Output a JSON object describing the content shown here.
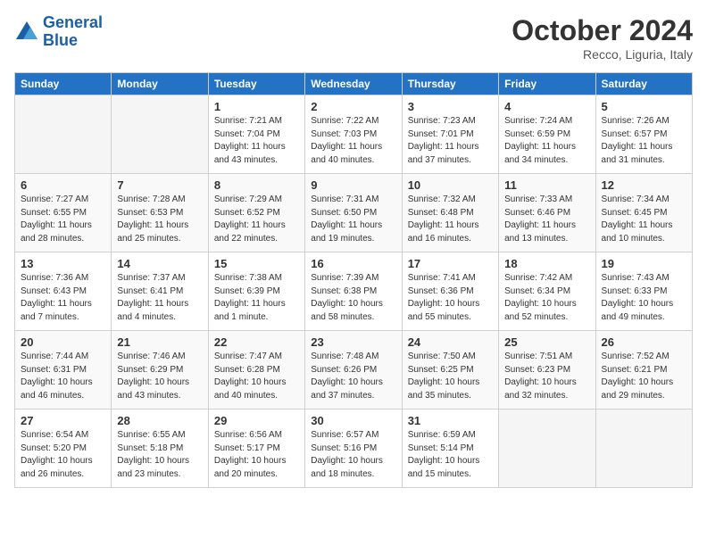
{
  "header": {
    "logo_line1": "General",
    "logo_line2": "Blue",
    "month": "October 2024",
    "location": "Recco, Liguria, Italy"
  },
  "days_of_week": [
    "Sunday",
    "Monday",
    "Tuesday",
    "Wednesday",
    "Thursday",
    "Friday",
    "Saturday"
  ],
  "weeks": [
    [
      {
        "day": "",
        "info": ""
      },
      {
        "day": "",
        "info": ""
      },
      {
        "day": "1",
        "info": "Sunrise: 7:21 AM\nSunset: 7:04 PM\nDaylight: 11 hours and 43 minutes."
      },
      {
        "day": "2",
        "info": "Sunrise: 7:22 AM\nSunset: 7:03 PM\nDaylight: 11 hours and 40 minutes."
      },
      {
        "day": "3",
        "info": "Sunrise: 7:23 AM\nSunset: 7:01 PM\nDaylight: 11 hours and 37 minutes."
      },
      {
        "day": "4",
        "info": "Sunrise: 7:24 AM\nSunset: 6:59 PM\nDaylight: 11 hours and 34 minutes."
      },
      {
        "day": "5",
        "info": "Sunrise: 7:26 AM\nSunset: 6:57 PM\nDaylight: 11 hours and 31 minutes."
      }
    ],
    [
      {
        "day": "6",
        "info": "Sunrise: 7:27 AM\nSunset: 6:55 PM\nDaylight: 11 hours and 28 minutes."
      },
      {
        "day": "7",
        "info": "Sunrise: 7:28 AM\nSunset: 6:53 PM\nDaylight: 11 hours and 25 minutes."
      },
      {
        "day": "8",
        "info": "Sunrise: 7:29 AM\nSunset: 6:52 PM\nDaylight: 11 hours and 22 minutes."
      },
      {
        "day": "9",
        "info": "Sunrise: 7:31 AM\nSunset: 6:50 PM\nDaylight: 11 hours and 19 minutes."
      },
      {
        "day": "10",
        "info": "Sunrise: 7:32 AM\nSunset: 6:48 PM\nDaylight: 11 hours and 16 minutes."
      },
      {
        "day": "11",
        "info": "Sunrise: 7:33 AM\nSunset: 6:46 PM\nDaylight: 11 hours and 13 minutes."
      },
      {
        "day": "12",
        "info": "Sunrise: 7:34 AM\nSunset: 6:45 PM\nDaylight: 11 hours and 10 minutes."
      }
    ],
    [
      {
        "day": "13",
        "info": "Sunrise: 7:36 AM\nSunset: 6:43 PM\nDaylight: 11 hours and 7 minutes."
      },
      {
        "day": "14",
        "info": "Sunrise: 7:37 AM\nSunset: 6:41 PM\nDaylight: 11 hours and 4 minutes."
      },
      {
        "day": "15",
        "info": "Sunrise: 7:38 AM\nSunset: 6:39 PM\nDaylight: 11 hours and 1 minute."
      },
      {
        "day": "16",
        "info": "Sunrise: 7:39 AM\nSunset: 6:38 PM\nDaylight: 10 hours and 58 minutes."
      },
      {
        "day": "17",
        "info": "Sunrise: 7:41 AM\nSunset: 6:36 PM\nDaylight: 10 hours and 55 minutes."
      },
      {
        "day": "18",
        "info": "Sunrise: 7:42 AM\nSunset: 6:34 PM\nDaylight: 10 hours and 52 minutes."
      },
      {
        "day": "19",
        "info": "Sunrise: 7:43 AM\nSunset: 6:33 PM\nDaylight: 10 hours and 49 minutes."
      }
    ],
    [
      {
        "day": "20",
        "info": "Sunrise: 7:44 AM\nSunset: 6:31 PM\nDaylight: 10 hours and 46 minutes."
      },
      {
        "day": "21",
        "info": "Sunrise: 7:46 AM\nSunset: 6:29 PM\nDaylight: 10 hours and 43 minutes."
      },
      {
        "day": "22",
        "info": "Sunrise: 7:47 AM\nSunset: 6:28 PM\nDaylight: 10 hours and 40 minutes."
      },
      {
        "day": "23",
        "info": "Sunrise: 7:48 AM\nSunset: 6:26 PM\nDaylight: 10 hours and 37 minutes."
      },
      {
        "day": "24",
        "info": "Sunrise: 7:50 AM\nSunset: 6:25 PM\nDaylight: 10 hours and 35 minutes."
      },
      {
        "day": "25",
        "info": "Sunrise: 7:51 AM\nSunset: 6:23 PM\nDaylight: 10 hours and 32 minutes."
      },
      {
        "day": "26",
        "info": "Sunrise: 7:52 AM\nSunset: 6:21 PM\nDaylight: 10 hours and 29 minutes."
      }
    ],
    [
      {
        "day": "27",
        "info": "Sunrise: 6:54 AM\nSunset: 5:20 PM\nDaylight: 10 hours and 26 minutes."
      },
      {
        "day": "28",
        "info": "Sunrise: 6:55 AM\nSunset: 5:18 PM\nDaylight: 10 hours and 23 minutes."
      },
      {
        "day": "29",
        "info": "Sunrise: 6:56 AM\nSunset: 5:17 PM\nDaylight: 10 hours and 20 minutes."
      },
      {
        "day": "30",
        "info": "Sunrise: 6:57 AM\nSunset: 5:16 PM\nDaylight: 10 hours and 18 minutes."
      },
      {
        "day": "31",
        "info": "Sunrise: 6:59 AM\nSunset: 5:14 PM\nDaylight: 10 hours and 15 minutes."
      },
      {
        "day": "",
        "info": ""
      },
      {
        "day": "",
        "info": ""
      }
    ]
  ]
}
